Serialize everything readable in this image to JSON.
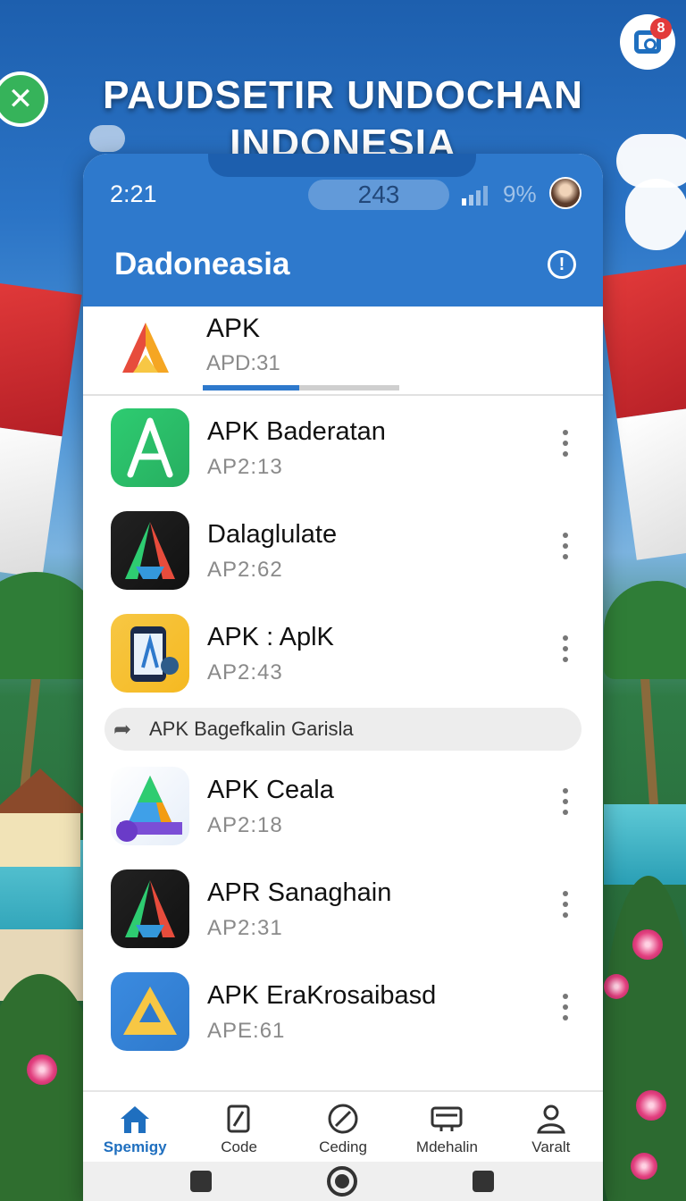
{
  "poster_title_line1": "PAUDSETIR UNDOCHAN",
  "poster_title_line2": "INDONESIA",
  "corner_badge_count": "8",
  "status_bar": {
    "time": "2:21",
    "center_pill": "243",
    "battery": "9%"
  },
  "app_bar": {
    "title": "Dadoneasia"
  },
  "pinned_app": {
    "name": "APK",
    "subtitle": "APD:31",
    "progress": 0.49
  },
  "apps": [
    {
      "name": "APK Baderatan",
      "subtitle": "AP2:13",
      "icon": "green-a-icon"
    },
    {
      "name": "Dalaglulate",
      "subtitle": "AP2:62",
      "icon": "black-a-icon"
    },
    {
      "name": "APK : AplK",
      "subtitle": "AP2:43",
      "icon": "phone-app-icon"
    }
  ],
  "suggestion_banner": {
    "text": "APK Bagefkalin Garisla"
  },
  "apps_more": [
    {
      "name": "APK Ceala",
      "subtitle": "AP2:18",
      "icon": "rainbow-a-icon"
    },
    {
      "name": "APR Sanaghain",
      "subtitle": "AP2:31",
      "icon": "black-a-icon"
    },
    {
      "name": "APK EraKrosaibasd",
      "subtitle": "APE:61",
      "icon": "blue-a-icon"
    }
  ],
  "bottom_nav": [
    {
      "label": "Spemigy",
      "icon": "home-icon",
      "active": true
    },
    {
      "label": "Code",
      "icon": "code-icon",
      "active": false
    },
    {
      "label": "Ceding",
      "icon": "compass-icon",
      "active": false
    },
    {
      "label": "Mdehalin",
      "icon": "card-icon",
      "active": false
    },
    {
      "label": "Varalt",
      "icon": "profile-icon",
      "active": false
    }
  ],
  "colors": {
    "primary": "#2e79cc",
    "active_tab": "#1f6fbf",
    "badge_red": "#e23a3a"
  }
}
